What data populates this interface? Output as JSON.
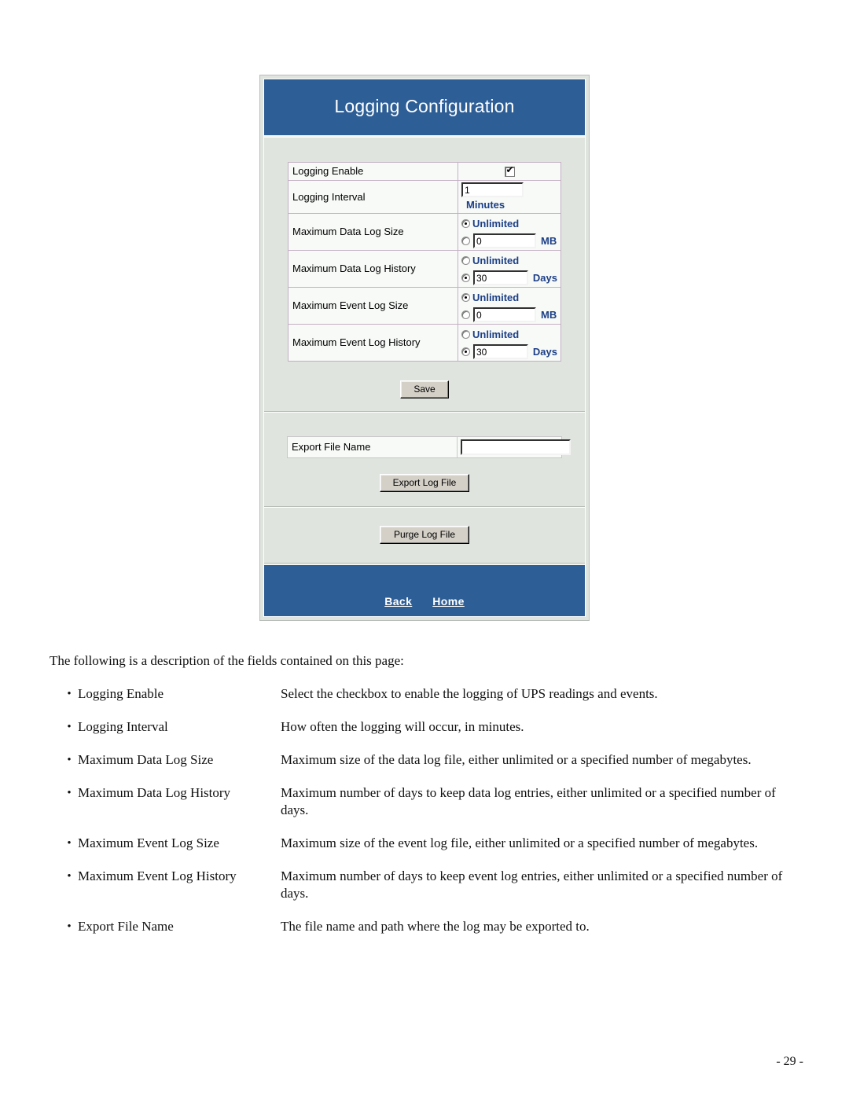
{
  "screenshot": {
    "banner_title": "Logging Configuration",
    "colors": {
      "banner_blue": "#2e5e96",
      "panel_gray": "#dfe4de",
      "label_blue": "#1d3f87",
      "table_border": "#c3b0c3"
    },
    "config_rows": [
      {
        "label": "Logging Enable",
        "control": "checkbox",
        "checked": true
      },
      {
        "label": "Logging Interval",
        "control": "text",
        "value": "1",
        "unit": "Minutes"
      },
      {
        "label": "Maximum Data Log Size",
        "control": "radio-pair",
        "unlimited_label": "Unlimited",
        "unlimited_selected": true,
        "value": "0",
        "unit": "MB"
      },
      {
        "label": "Maximum Data Log History",
        "control": "radio-pair",
        "unlimited_label": "Unlimited",
        "unlimited_selected": false,
        "value": "30",
        "unit": "Days"
      },
      {
        "label": "Maximum Event Log Size",
        "control": "radio-pair",
        "unlimited_label": "Unlimited",
        "unlimited_selected": true,
        "value": "0",
        "unit": "MB"
      },
      {
        "label": "Maximum Event Log History",
        "control": "radio-pair",
        "unlimited_label": "Unlimited",
        "unlimited_selected": false,
        "value": "30",
        "unit": "Days"
      }
    ],
    "save_button": "Save",
    "export": {
      "label": "Export File Name",
      "value": "",
      "button": "Export Log File"
    },
    "purge": {
      "button": "Purge Log File"
    },
    "footer": {
      "back": "Back",
      "home": "Home"
    }
  },
  "document": {
    "intro": "The following is a description of the fields contained on this page:",
    "bullet_glyph": "•",
    "definitions": [
      {
        "term": "Logging Enable",
        "description": "Select the checkbox to enable the logging of UPS readings and events."
      },
      {
        "term": "Logging Interval",
        "description": "How often the logging will occur, in minutes."
      },
      {
        "term": "Maximum Data Log Size",
        "description": "Maximum size of the data log file, either unlimited or a specified number of megabytes."
      },
      {
        "term": "Maximum Data Log History",
        "description": "Maximum number of days to keep data log entries, either unlimited or a specified number of days."
      },
      {
        "term": "Maximum Event Log Size",
        "description": "Maximum size of the event log file, either unlimited or a specified number of megabytes."
      },
      {
        "term": "Maximum Event Log History",
        "description": "Maximum number of days to keep event log entries, either unlimited or a specified number of days."
      },
      {
        "term": "Export File Name",
        "description": "The file name and path where the log may be exported to."
      }
    ],
    "page_number": "- 29 -"
  }
}
